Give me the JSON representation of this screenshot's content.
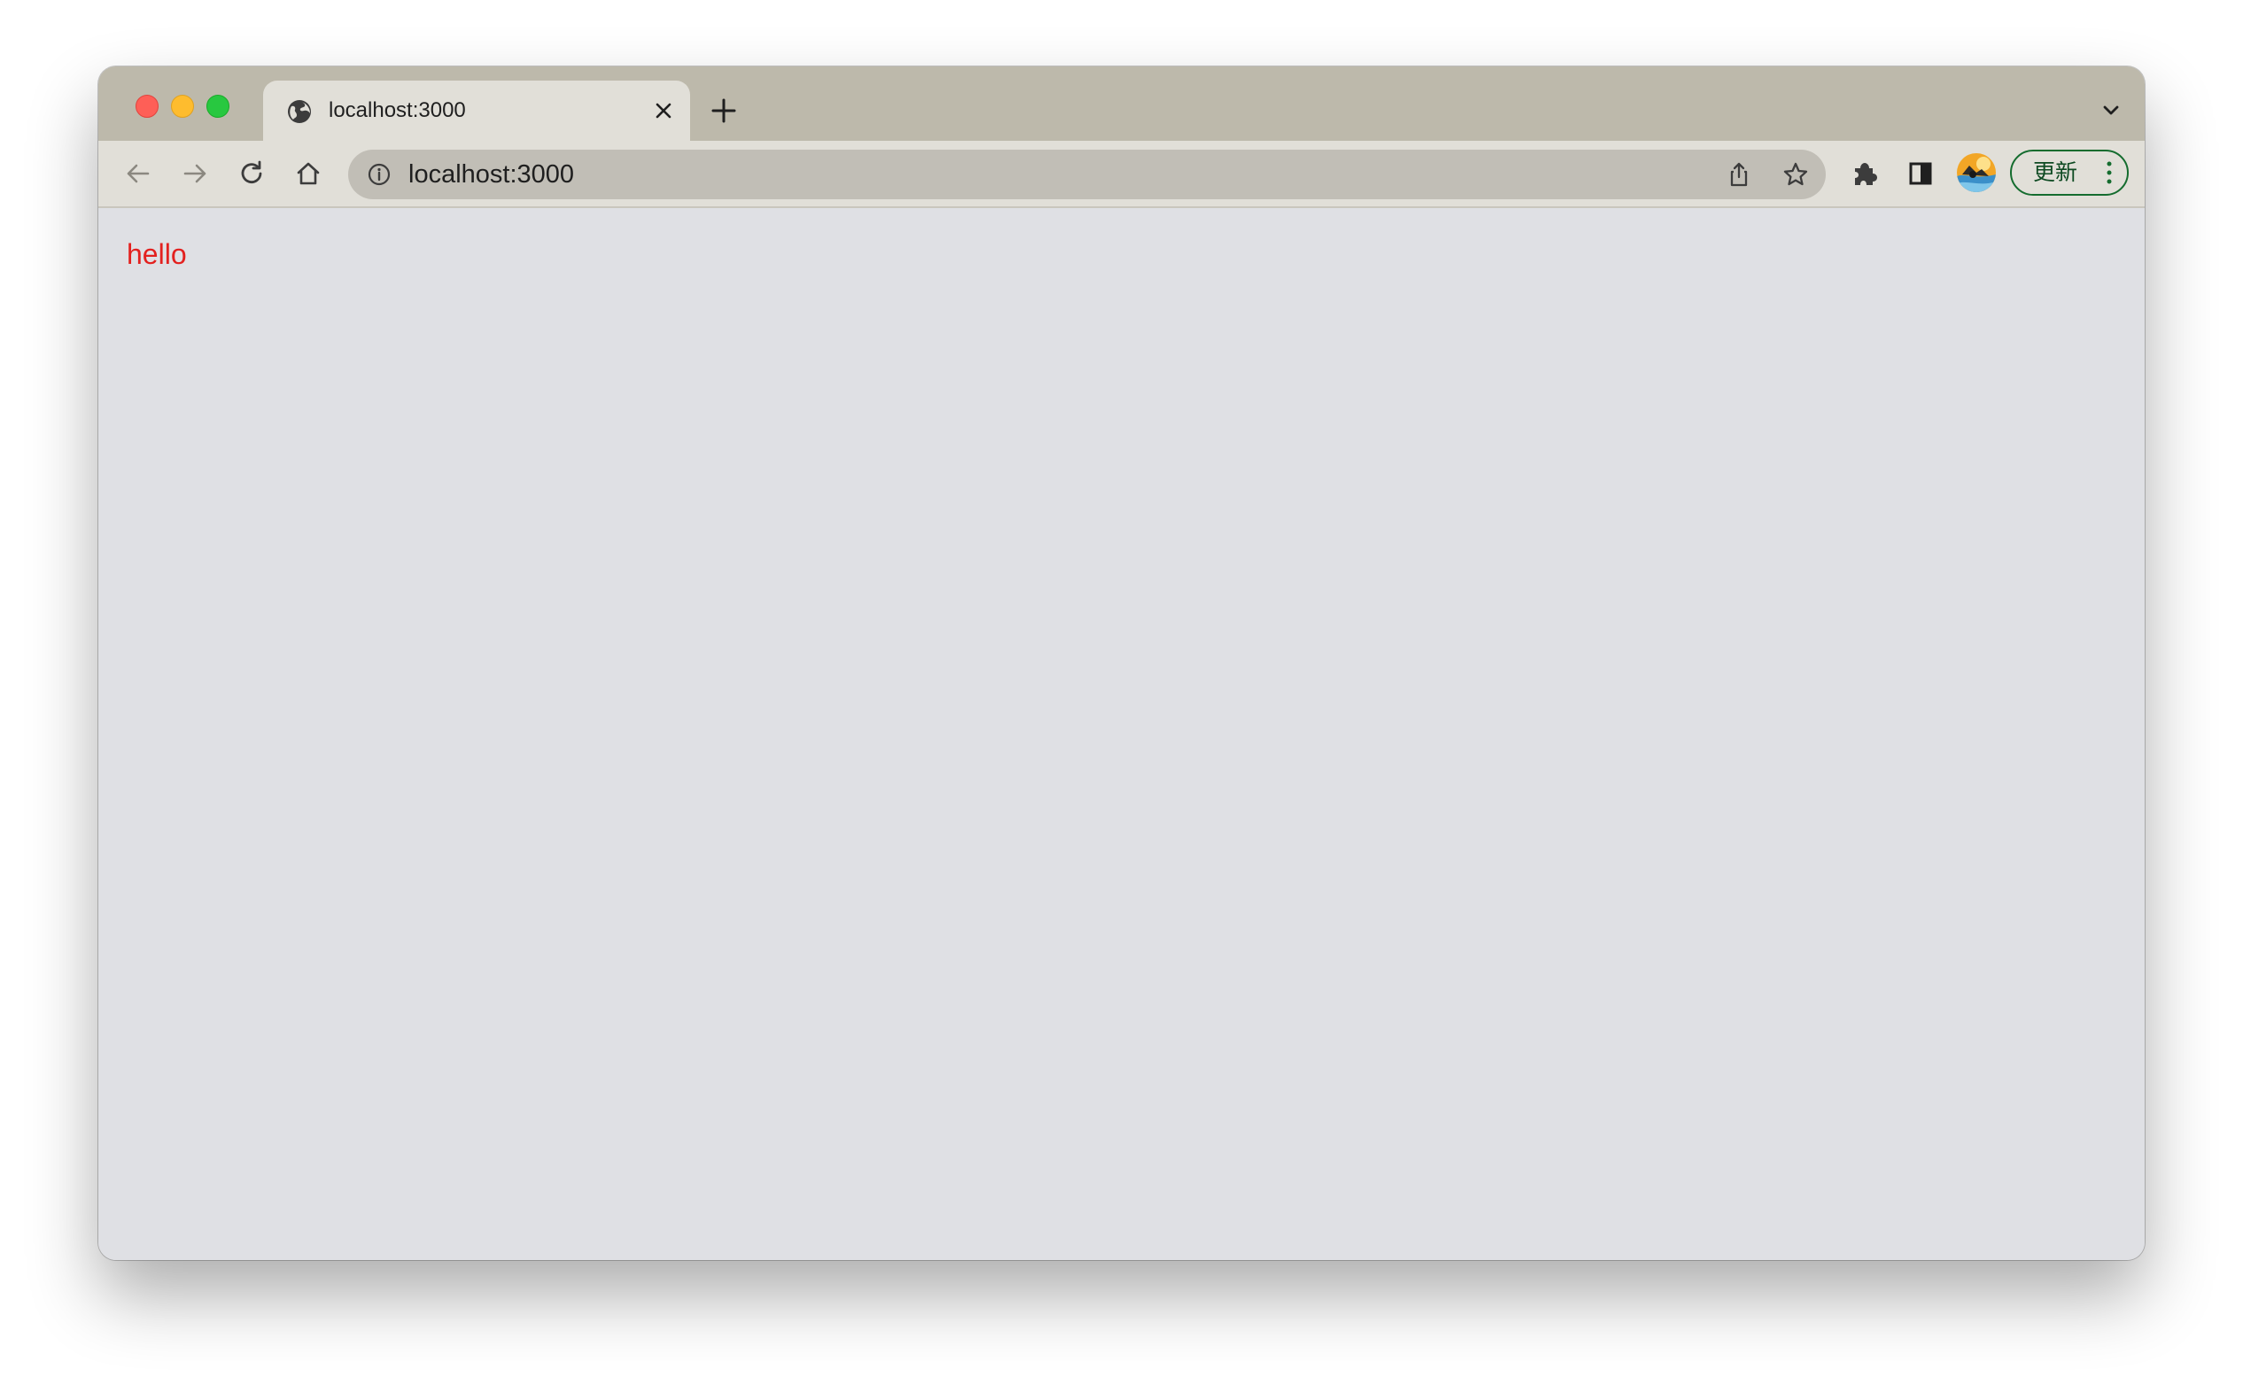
{
  "tab": {
    "title": "localhost:3000"
  },
  "omnibox": {
    "url": "localhost:3000"
  },
  "toolbar": {
    "update_label": "更新"
  },
  "page": {
    "text": "hello",
    "text_color": "#e3211f"
  },
  "colors": {
    "tab_strip": "#bdb9ab",
    "toolbar": "#e1dfd8",
    "omnibox": "#c1beb6",
    "page_background": "#dfe0e4",
    "update_accent": "#146c2e"
  },
  "icons": {
    "traffic_lights": [
      "close-window-icon",
      "minimize-window-icon",
      "maximize-window-icon"
    ],
    "tab_favicon": "globe-icon",
    "tab_close": "close-icon",
    "new_tab": "plus-icon",
    "tab_list": "chevron-down-icon",
    "back": "arrow-left-icon",
    "forward": "arrow-right-icon",
    "reload": "reload-icon",
    "home": "home-icon",
    "site_info": "info-icon",
    "share": "share-icon",
    "bookmark": "star-icon",
    "extensions": "puzzle-icon",
    "side_panel": "side-panel-icon",
    "profile": "avatar",
    "menu": "more-vertical-icon"
  }
}
